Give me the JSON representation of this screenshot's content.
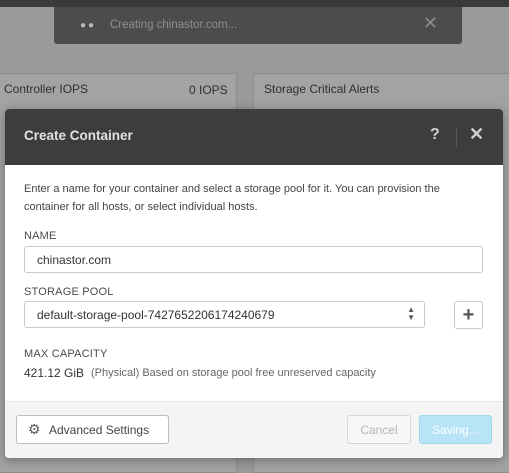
{
  "background": {
    "panel_left_title": "Controller IOPS",
    "panel_left_value": "0 IOPS",
    "panel_right_title": "Storage Critical Alerts"
  },
  "toast": {
    "message": "Creating chinastor.com...",
    "close_symbol": "✕"
  },
  "dialog": {
    "title": "Create Container",
    "help_symbol": "?",
    "close_symbol": "✕",
    "description": "Enter a name for your container and select a storage pool for it. You can provision the container for all hosts, or select individual hosts.",
    "name_label": "NAME",
    "name_value": "chinastor.com",
    "storage_pool_label": "STORAGE POOL",
    "storage_pool_value": "default-storage-pool-7427652206174240679",
    "add_symbol": "+",
    "max_capacity_label": "MAX CAPACITY",
    "max_capacity_value": "421.12 GiB",
    "max_capacity_note": "(Physical) Based on storage pool free unreserved capacity"
  },
  "footer": {
    "advanced_settings_label": "Advanced Settings",
    "cancel_label": "Cancel",
    "save_label": "Saving..."
  },
  "icons": {
    "gear": "gear-icon",
    "spinner": "spinner-icon",
    "select_arrows": "select-arrows-icon",
    "plus": "plus-icon",
    "close": "close-icon",
    "help": "help-icon"
  },
  "colors": {
    "header_bg": "#3d3d3d",
    "primary_disabled": "#b9e4f7",
    "overlay": "#9a9a9a"
  }
}
